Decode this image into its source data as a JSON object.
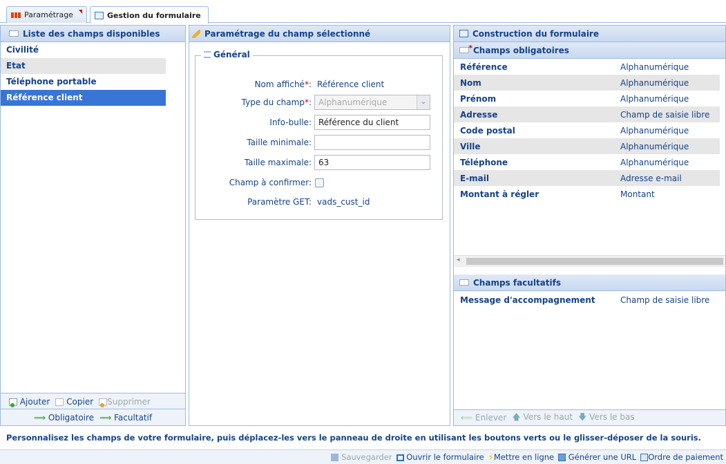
{
  "tabs": [
    {
      "label": "Paramétrage"
    },
    {
      "label": "Gestion du formulaire"
    }
  ],
  "left_panel": {
    "title": "Liste des champs disponibles",
    "items": [
      {
        "label": "Civilité"
      },
      {
        "label": "Etat"
      },
      {
        "label": "Téléphone portable"
      },
      {
        "label": "Référence client"
      }
    ],
    "toolbar": {
      "add": "Ajouter",
      "copy": "Copier",
      "delete": "Supprimer"
    },
    "move": {
      "required": "Obligatoire",
      "optional": "Facultatif"
    }
  },
  "middle_panel": {
    "title": "Paramétrage du champ sélectionné",
    "fieldset_title": "Général",
    "fields": {
      "display_name_label": "Nom affiché",
      "display_name_value": "Référence client",
      "type_label": "Type du champ",
      "type_value": "Alphanumérique",
      "tooltip_label": "Info-bulle",
      "tooltip_value": "Référence du client",
      "min_label": "Taille minimale:",
      "min_value": "",
      "max_label": "Taille maximale:",
      "max_value": "63",
      "confirm_label": "Champ à confirmer:",
      "get_label": "Paramètre GET:",
      "get_value": "vads_cust_id"
    }
  },
  "right_panel": {
    "title": "Construction du formulaire",
    "required_title": "Champs obligatoires",
    "required_rows": [
      {
        "name": "Référence",
        "type": "Alphanumérique"
      },
      {
        "name": "Nom",
        "type": "Alphanumérique"
      },
      {
        "name": "Prénom",
        "type": "Alphanumérique"
      },
      {
        "name": "Adresse",
        "type": "Champ de saisie libre"
      },
      {
        "name": "Code postal",
        "type": "Alphanumérique"
      },
      {
        "name": "Ville",
        "type": "Alphanumérique"
      },
      {
        "name": "Téléphone",
        "type": "Alphanumérique"
      },
      {
        "name": "E-mail",
        "type": "Adresse e-mail"
      },
      {
        "name": "Montant à régler",
        "type": "Montant"
      }
    ],
    "optional_title": "Champs facultatifs",
    "optional_rows": [
      {
        "name": "Message d'accompagnement",
        "type": "Champ de saisie libre"
      }
    ],
    "toolbar": {
      "remove": "Enlever",
      "up": "Vers le haut",
      "down": "Vers le bas"
    }
  },
  "hint": "Personnalisez les champs de votre formulaire, puis déplacez-les vers le panneau de droite en utilisant les boutons verts ou le glisser-déposer de la souris.",
  "footer": {
    "save": "Sauvegarder",
    "open": "Ouvrir le formulaire",
    "publish": "Mettre en ligne",
    "generate": "Générer une URL",
    "order": "Ordre de paiement"
  }
}
